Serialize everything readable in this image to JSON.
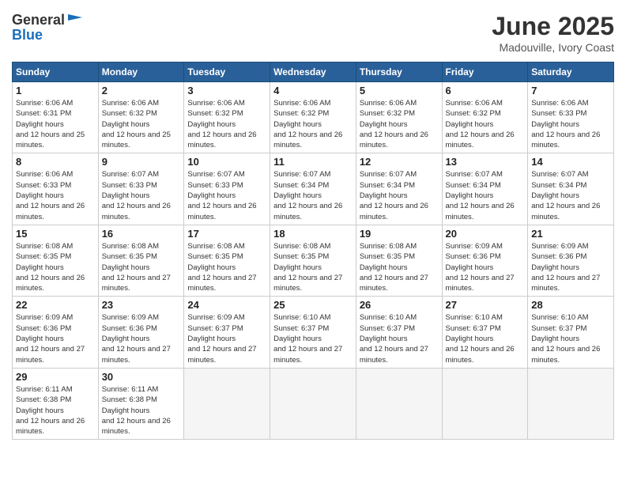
{
  "logo": {
    "general": "General",
    "blue": "Blue"
  },
  "title": "June 2025",
  "location": "Madouville, Ivory Coast",
  "days_of_week": [
    "Sunday",
    "Monday",
    "Tuesday",
    "Wednesday",
    "Thursday",
    "Friday",
    "Saturday"
  ],
  "weeks": [
    [
      {
        "day": "1",
        "sunrise": "6:06 AM",
        "sunset": "6:31 PM",
        "daylight": "12 hours and 25 minutes."
      },
      {
        "day": "2",
        "sunrise": "6:06 AM",
        "sunset": "6:32 PM",
        "daylight": "12 hours and 25 minutes."
      },
      {
        "day": "3",
        "sunrise": "6:06 AM",
        "sunset": "6:32 PM",
        "daylight": "12 hours and 26 minutes."
      },
      {
        "day": "4",
        "sunrise": "6:06 AM",
        "sunset": "6:32 PM",
        "daylight": "12 hours and 26 minutes."
      },
      {
        "day": "5",
        "sunrise": "6:06 AM",
        "sunset": "6:32 PM",
        "daylight": "12 hours and 26 minutes."
      },
      {
        "day": "6",
        "sunrise": "6:06 AM",
        "sunset": "6:32 PM",
        "daylight": "12 hours and 26 minutes."
      },
      {
        "day": "7",
        "sunrise": "6:06 AM",
        "sunset": "6:33 PM",
        "daylight": "12 hours and 26 minutes."
      }
    ],
    [
      {
        "day": "8",
        "sunrise": "6:06 AM",
        "sunset": "6:33 PM",
        "daylight": "12 hours and 26 minutes."
      },
      {
        "day": "9",
        "sunrise": "6:07 AM",
        "sunset": "6:33 PM",
        "daylight": "12 hours and 26 minutes."
      },
      {
        "day": "10",
        "sunrise": "6:07 AM",
        "sunset": "6:33 PM",
        "daylight": "12 hours and 26 minutes."
      },
      {
        "day": "11",
        "sunrise": "6:07 AM",
        "sunset": "6:34 PM",
        "daylight": "12 hours and 26 minutes."
      },
      {
        "day": "12",
        "sunrise": "6:07 AM",
        "sunset": "6:34 PM",
        "daylight": "12 hours and 26 minutes."
      },
      {
        "day": "13",
        "sunrise": "6:07 AM",
        "sunset": "6:34 PM",
        "daylight": "12 hours and 26 minutes."
      },
      {
        "day": "14",
        "sunrise": "6:07 AM",
        "sunset": "6:34 PM",
        "daylight": "12 hours and 26 minutes."
      }
    ],
    [
      {
        "day": "15",
        "sunrise": "6:08 AM",
        "sunset": "6:35 PM",
        "daylight": "12 hours and 26 minutes."
      },
      {
        "day": "16",
        "sunrise": "6:08 AM",
        "sunset": "6:35 PM",
        "daylight": "12 hours and 27 minutes."
      },
      {
        "day": "17",
        "sunrise": "6:08 AM",
        "sunset": "6:35 PM",
        "daylight": "12 hours and 27 minutes."
      },
      {
        "day": "18",
        "sunrise": "6:08 AM",
        "sunset": "6:35 PM",
        "daylight": "12 hours and 27 minutes."
      },
      {
        "day": "19",
        "sunrise": "6:08 AM",
        "sunset": "6:35 PM",
        "daylight": "12 hours and 27 minutes."
      },
      {
        "day": "20",
        "sunrise": "6:09 AM",
        "sunset": "6:36 PM",
        "daylight": "12 hours and 27 minutes."
      },
      {
        "day": "21",
        "sunrise": "6:09 AM",
        "sunset": "6:36 PM",
        "daylight": "12 hours and 27 minutes."
      }
    ],
    [
      {
        "day": "22",
        "sunrise": "6:09 AM",
        "sunset": "6:36 PM",
        "daylight": "12 hours and 27 minutes."
      },
      {
        "day": "23",
        "sunrise": "6:09 AM",
        "sunset": "6:36 PM",
        "daylight": "12 hours and 27 minutes."
      },
      {
        "day": "24",
        "sunrise": "6:09 AM",
        "sunset": "6:37 PM",
        "daylight": "12 hours and 27 minutes."
      },
      {
        "day": "25",
        "sunrise": "6:10 AM",
        "sunset": "6:37 PM",
        "daylight": "12 hours and 27 minutes."
      },
      {
        "day": "26",
        "sunrise": "6:10 AM",
        "sunset": "6:37 PM",
        "daylight": "12 hours and 27 minutes."
      },
      {
        "day": "27",
        "sunrise": "6:10 AM",
        "sunset": "6:37 PM",
        "daylight": "12 hours and 26 minutes."
      },
      {
        "day": "28",
        "sunrise": "6:10 AM",
        "sunset": "6:37 PM",
        "daylight": "12 hours and 26 minutes."
      }
    ],
    [
      {
        "day": "29",
        "sunrise": "6:11 AM",
        "sunset": "6:38 PM",
        "daylight": "12 hours and 26 minutes."
      },
      {
        "day": "30",
        "sunrise": "6:11 AM",
        "sunset": "6:38 PM",
        "daylight": "12 hours and 26 minutes."
      },
      null,
      null,
      null,
      null,
      null
    ]
  ]
}
